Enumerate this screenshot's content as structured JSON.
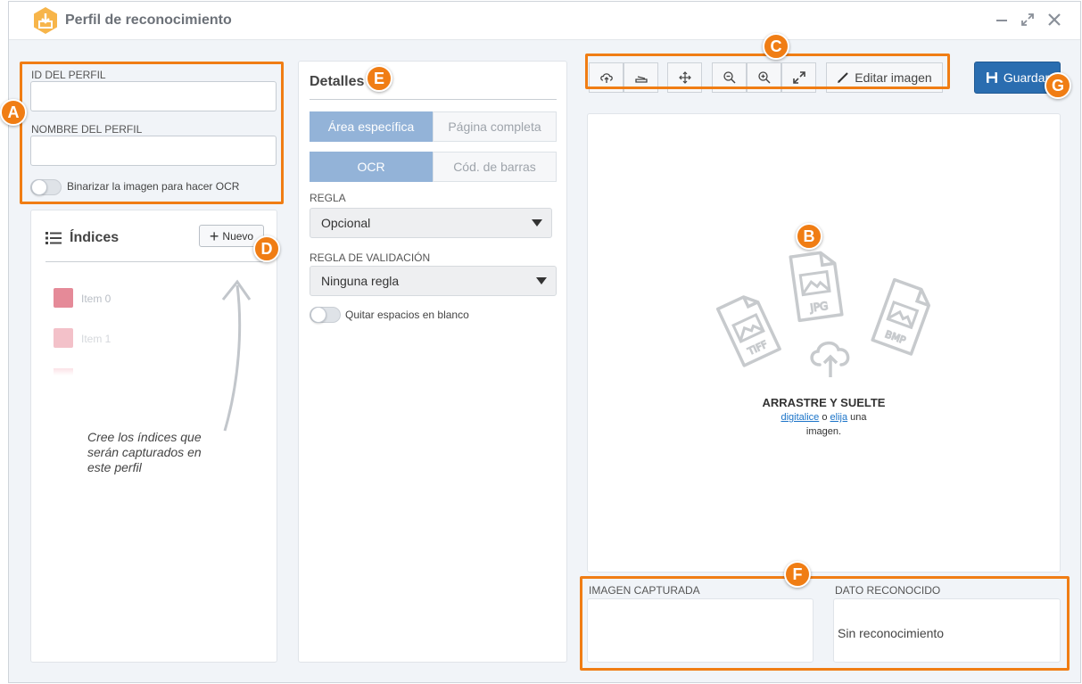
{
  "window": {
    "title": "Perfil de reconocimiento",
    "app_icon": "download-tray-icon",
    "controls": [
      "minimize-icon",
      "expand-icon",
      "close-icon"
    ]
  },
  "profile": {
    "id_label": "ID DEL PERFIL",
    "id_value": "",
    "name_label": "NOMBRE DEL PERFIL",
    "name_value": "",
    "binarize_label": "Binarizar la imagen para hacer OCR",
    "binarize_on": false
  },
  "indices": {
    "title": "Índices",
    "new_button": "Nuevo",
    "items": [
      "Item 0",
      "Item 1"
    ],
    "hint": [
      "Cree los índices que",
      "serán capturados en",
      "este perfil"
    ]
  },
  "details": {
    "title": "Detalles",
    "area_tabs": [
      "Área específica",
      "Página completa"
    ],
    "area_selected": "Área específica",
    "mode_tabs": [
      "OCR",
      "Cód. de barras"
    ],
    "mode_selected": "OCR",
    "rule_label": "REGLA",
    "rule_value": "Opcional",
    "validation_label": "REGLA DE VALIDACIÓN",
    "validation_value": "Ninguna regla",
    "strip_spaces_label": "Quitar espacios en blanco",
    "strip_spaces_on": false
  },
  "toolbar": {
    "icons": [
      "cloud-upload-icon",
      "scanner-icon",
      "move-icon",
      "zoom-out-icon",
      "zoom-in-icon",
      "fit-screen-icon"
    ],
    "edit_label": "Editar imagen",
    "save_label": "Guardar"
  },
  "dropzone": {
    "file_types": [
      "TIFF",
      "JPG",
      "BMP"
    ],
    "title": "ARRASTRE Y SUELTE",
    "link_scan": "digitalice",
    "text_or": "o",
    "link_choose": "elija",
    "text_a": "una",
    "text_image": "imagen."
  },
  "result": {
    "captured_label": "IMAGEN CAPTURADA",
    "recognized_label": "DATO RECONOCIDO",
    "recognized_value": "Sin reconocimiento"
  },
  "markers": [
    "A",
    "B",
    "C",
    "D",
    "E",
    "F",
    "G"
  ],
  "colors": {
    "accent_orange": "#f07d14",
    "primary_blue": "#2a6db0",
    "segment_active": "#93b3d8",
    "item_0": "#e58a98",
    "item_1": "#f3c1c9"
  }
}
